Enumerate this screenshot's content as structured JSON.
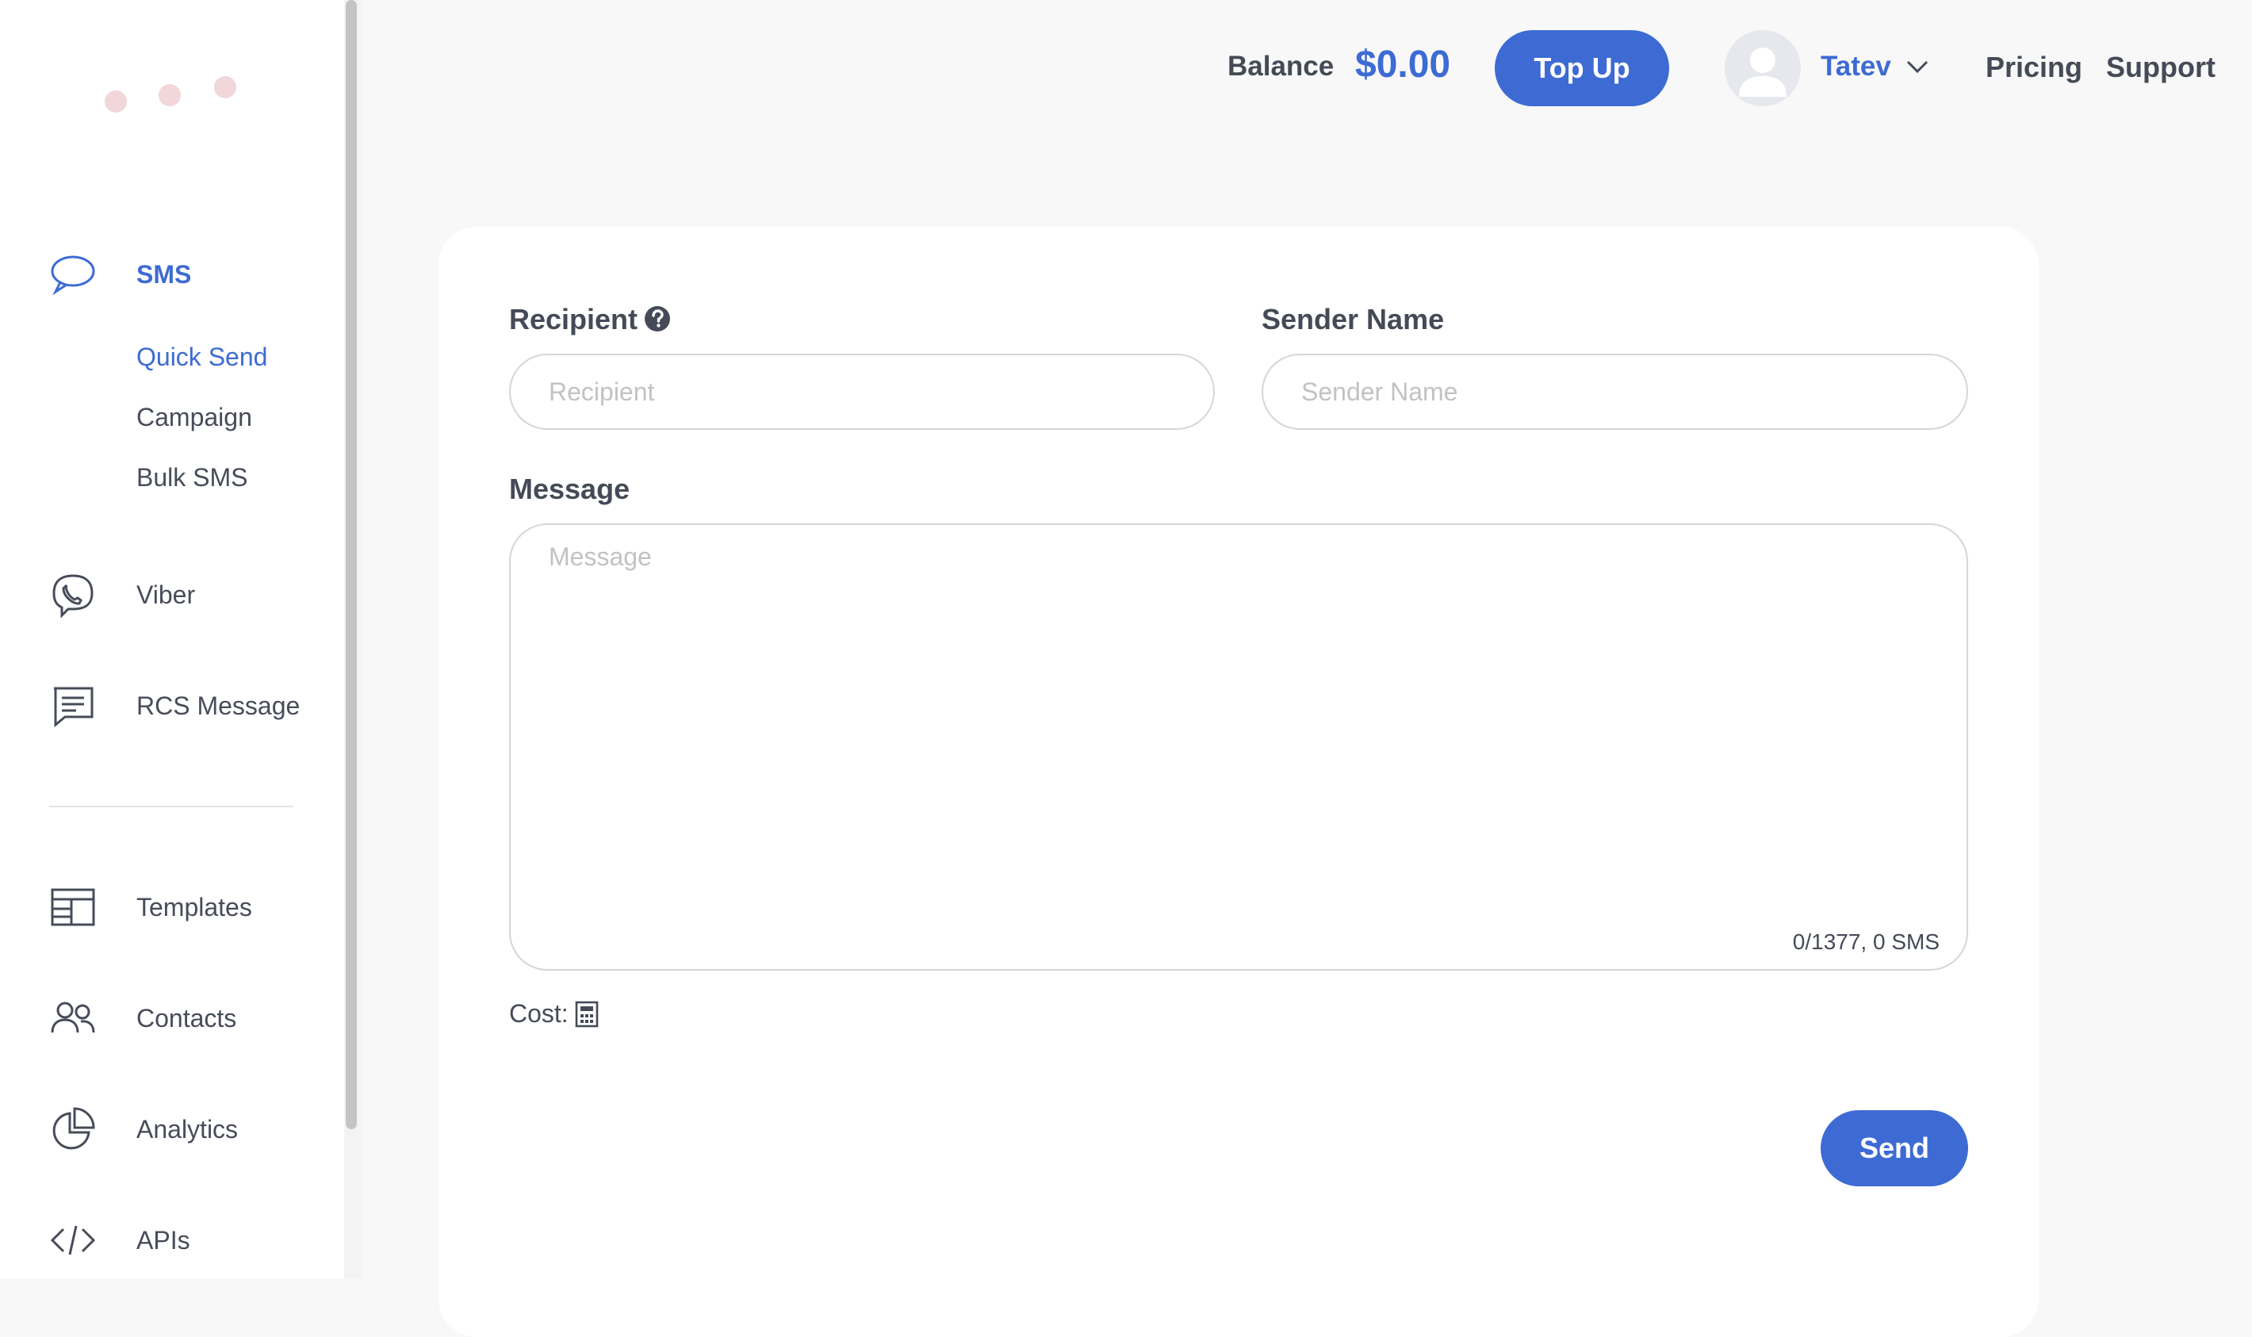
{
  "sidebar": {
    "sections": [
      {
        "label": "SMS",
        "icon": "chat-bubbles-icon",
        "active": true
      },
      {
        "label": "Viber",
        "icon": "viber-icon"
      },
      {
        "label": "RCS Message",
        "icon": "message-lines-icon"
      },
      {
        "label": "Templates",
        "icon": "templates-layout-icon"
      },
      {
        "label": "Contacts",
        "icon": "contacts-people-icon"
      },
      {
        "label": "Analytics",
        "icon": "pie-chart-icon"
      },
      {
        "label": "APIs",
        "icon": "code-brackets-icon"
      }
    ],
    "sms_sub": [
      {
        "label": "Quick Send",
        "active": true
      },
      {
        "label": "Campaign"
      },
      {
        "label": "Bulk SMS"
      }
    ]
  },
  "header": {
    "balance_label": "Balance",
    "balance_value": "$0.00",
    "topup_label": "Top Up",
    "user_name": "Tatev",
    "links": [
      "Pricing",
      "Support"
    ]
  },
  "form": {
    "recipient_label": "Recipient",
    "recipient_placeholder": "Recipient",
    "recipient_value": "",
    "sender_label": "Sender Name",
    "sender_placeholder": "Sender Name",
    "sender_value": "",
    "message_label": "Message",
    "message_placeholder": "Message",
    "message_value": "",
    "counter": "0/1377, 0 SMS",
    "cost_label": "Cost:",
    "send_label": "Send"
  },
  "colors": {
    "accent": "#3d6bd3",
    "text": "#454a57",
    "placeholder": "#c2c2c2",
    "border": "#d6d6d6",
    "background": "#f8f8f8",
    "logo_dot": "#f1d7da"
  }
}
